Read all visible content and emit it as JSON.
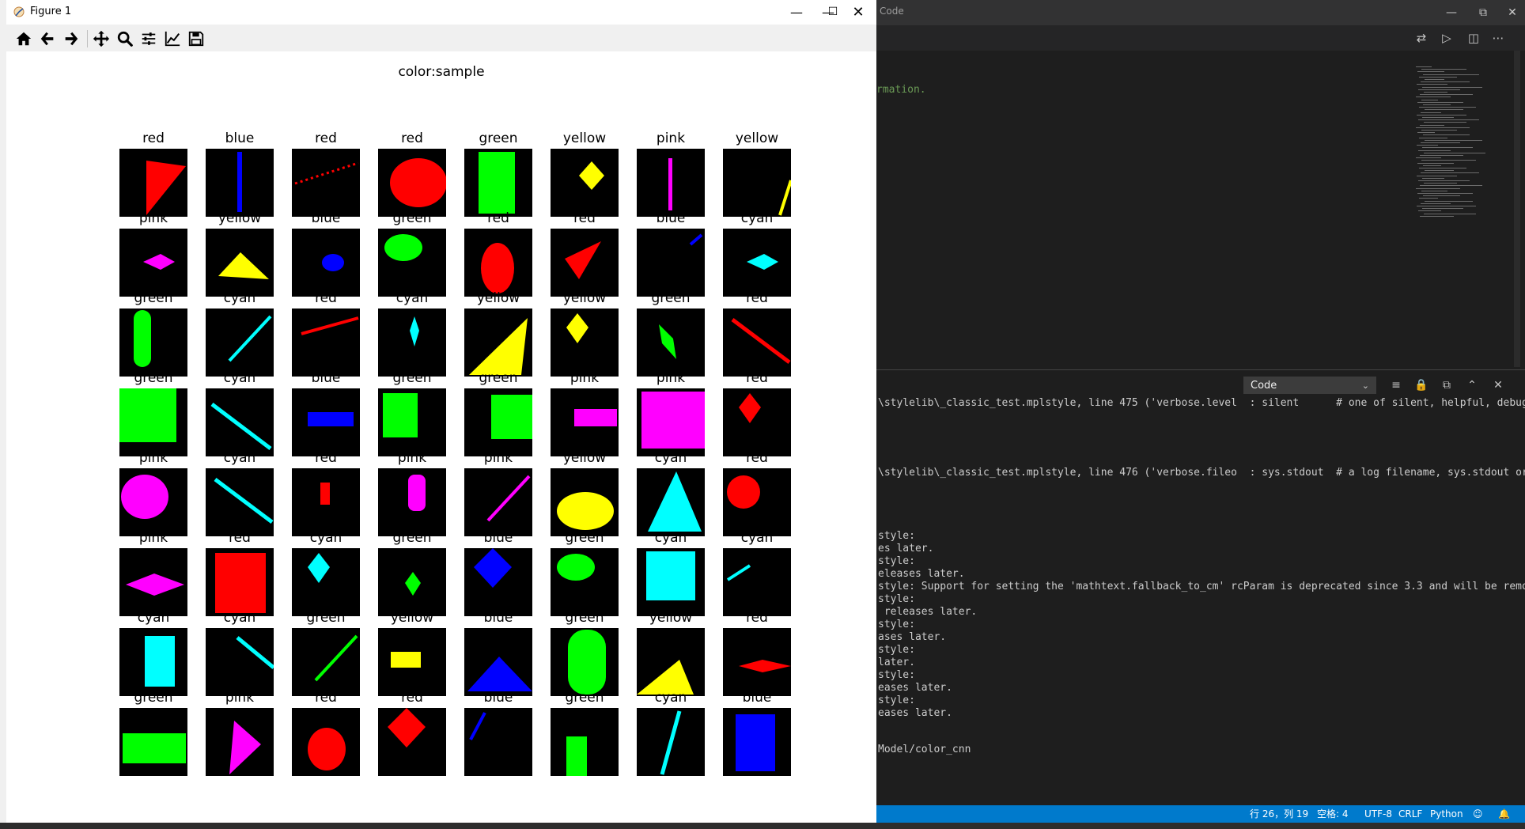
{
  "vscode": {
    "title": "Code",
    "code_text": "rmation.",
    "output_selector": "Code",
    "output_lines": [
      "\\stylelib\\_classic_test.mplstyle, line 475 ('verbose.level  : silent      # one of silent, helpful, debug",
      "\\stylelib\\_classic_test.mplstyle, line 476 ('verbose.fileo  : sys.stdout  # a log filename, sys.stdout or",
      "style:",
      "es later.",
      "style:",
      "eleases later.",
      "style: Support for setting the 'mathtext.fallback_to_cm' rcParam is deprecated since 3.3 and will be remo",
      "style:",
      " releases later.",
      "style:",
      "ases later.",
      "style:",
      "later.",
      "style:",
      "eases later.",
      "style:",
      "eases later.",
      "Model/color_cnn"
    ],
    "status": {
      "position": "行 26，列 19",
      "spaces": "空格: 4",
      "encoding": "UTF-8",
      "eol": "CRLF",
      "language": "Python"
    }
  },
  "figure": {
    "window_title": "Figure 1",
    "toolbar": [
      "home-icon",
      "back-icon",
      "forward-icon",
      "pan-icon",
      "zoom-icon",
      "configure-subplots-icon",
      "edit-axes-icon",
      "save-icon"
    ],
    "suptitle": "color:sample",
    "colors": {
      "red": "#ff0000",
      "blue": "#0000ff",
      "green": "#00ff00",
      "yellow": "#ffff00",
      "pink": "#ff00ff",
      "cyan": "#00ffff",
      "background": "#000000"
    },
    "samples": [
      [
        {
          "label": "red",
          "shape": "triangle"
        },
        {
          "label": "blue",
          "shape": "vline"
        },
        {
          "label": "red",
          "shape": "dotline"
        },
        {
          "label": "red",
          "shape": "circle"
        },
        {
          "label": "green",
          "shape": "rect-tall"
        },
        {
          "label": "yellow",
          "shape": "diamond"
        },
        {
          "label": "pink",
          "shape": "vline-thin"
        },
        {
          "label": "yellow",
          "shape": "edge-line"
        }
      ],
      [
        {
          "label": "pink",
          "shape": "spindle"
        },
        {
          "label": "yellow",
          "shape": "triangle-flat"
        },
        {
          "label": "blue",
          "shape": "small-oval"
        },
        {
          "label": "green",
          "shape": "oval-wide"
        },
        {
          "label": "red",
          "shape": "oval-tall"
        },
        {
          "label": "red",
          "shape": "triangle-slim"
        },
        {
          "label": "blue",
          "shape": "short-line"
        },
        {
          "label": "cyan",
          "shape": "spindle"
        }
      ],
      [
        {
          "label": "green",
          "shape": "capsule"
        },
        {
          "label": "cyan",
          "shape": "diag-line"
        },
        {
          "label": "red",
          "shape": "slope-line"
        },
        {
          "label": "cyan",
          "shape": "small-spindle-v"
        },
        {
          "label": "yellow",
          "shape": "big-triangle"
        },
        {
          "label": "yellow",
          "shape": "diamond-tall"
        },
        {
          "label": "green",
          "shape": "leaf"
        },
        {
          "label": "red",
          "shape": "diag-line-down"
        }
      ],
      [
        {
          "label": "green",
          "shape": "square-big"
        },
        {
          "label": "cyan",
          "shape": "diag-line-long"
        },
        {
          "label": "blue",
          "shape": "bar-h"
        },
        {
          "label": "green",
          "shape": "rect-med"
        },
        {
          "label": "green",
          "shape": "square-right"
        },
        {
          "label": "pink",
          "shape": "bar-h-right"
        },
        {
          "label": "pink",
          "shape": "square-full"
        },
        {
          "label": "red",
          "shape": "diamond-tall"
        }
      ],
      [
        {
          "label": "pink",
          "shape": "circle-big"
        },
        {
          "label": "cyan",
          "shape": "diag-line-down"
        },
        {
          "label": "red",
          "shape": "tiny-rect"
        },
        {
          "label": "pink",
          "shape": "capsule-small"
        },
        {
          "label": "pink",
          "shape": "diag-line"
        },
        {
          "label": "yellow",
          "shape": "ellipse"
        },
        {
          "label": "cyan",
          "shape": "big-triangle-up"
        },
        {
          "label": "red",
          "shape": "circle-small"
        }
      ],
      [
        {
          "label": "pink",
          "shape": "spindle-big"
        },
        {
          "label": "red",
          "shape": "rect-big"
        },
        {
          "label": "cyan",
          "shape": "diamond-tall"
        },
        {
          "label": "green",
          "shape": "diamond-small"
        },
        {
          "label": "blue",
          "shape": "diamond-big"
        },
        {
          "label": "green",
          "shape": "oval-wide"
        },
        {
          "label": "cyan",
          "shape": "square-med"
        },
        {
          "label": "cyan",
          "shape": "short-line-left"
        }
      ],
      [
        {
          "label": "cyan",
          "shape": "rect-tall-mid"
        },
        {
          "label": "cyan",
          "shape": "diag-corner"
        },
        {
          "label": "green",
          "shape": "diag-line"
        },
        {
          "label": "yellow",
          "shape": "small-rect"
        },
        {
          "label": "blue",
          "shape": "triangle-wide"
        },
        {
          "label": "green",
          "shape": "capsule-big"
        },
        {
          "label": "yellow",
          "shape": "triangle-low"
        },
        {
          "label": "red",
          "shape": "spindle-small"
        }
      ],
      [
        {
          "label": "green",
          "shape": "rect-wide"
        },
        {
          "label": "pink",
          "shape": "triangle-right"
        },
        {
          "label": "red",
          "shape": "circle-mid"
        },
        {
          "label": "red",
          "shape": "diamond-big"
        },
        {
          "label": "blue",
          "shape": "short-diag"
        },
        {
          "label": "green",
          "shape": "bar-bottom"
        },
        {
          "label": "cyan",
          "shape": "diag-long"
        },
        {
          "label": "blue",
          "shape": "rect-tall-big"
        }
      ]
    ]
  }
}
